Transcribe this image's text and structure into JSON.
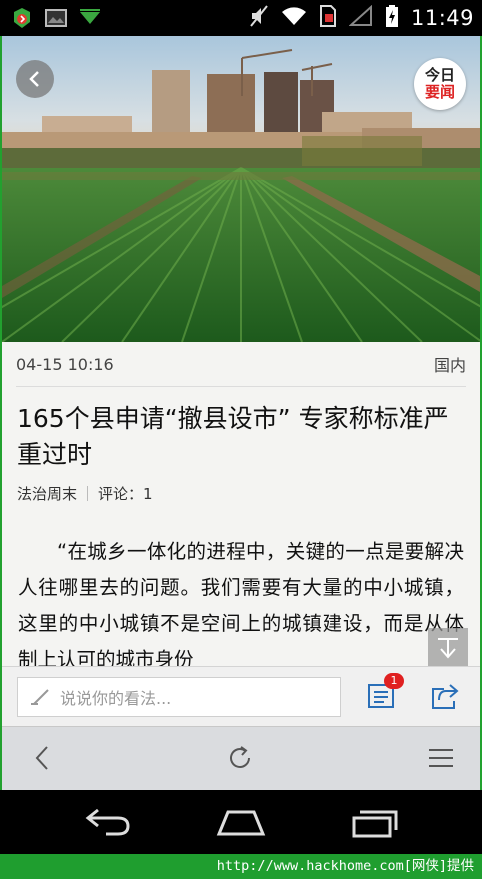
{
  "status_bar": {
    "time": "11:49",
    "icons": [
      "app-icon-green",
      "image-icon",
      "download-arrow-icon",
      "mute-icon",
      "wifi-icon",
      "no-sim-icon",
      "signal-icon",
      "battery-charging-icon"
    ]
  },
  "header": {
    "back_icon": "chevron-left-icon",
    "badge_line1": "今日",
    "badge_line2": "要闻"
  },
  "article": {
    "date": "04-15 10:16",
    "category": "国内",
    "title": "165个县申请“撤县设市” 专家称标准严重过时",
    "source": "法治周末",
    "comments_label": "评论：1",
    "body": "“在城乡一体化的进程中，关键的一点是要解决人往哪里去的问题。我们需要有大量的中小城镇，这里的中小城镇不是空间上的城镇建设，而是从体制上认可的城市身份"
  },
  "comment_bar": {
    "placeholder": "说说你的看法...",
    "comment_count": "1"
  },
  "browser_bar": {
    "icons": [
      "back-icon",
      "refresh-icon",
      "menu-icon"
    ]
  },
  "nav_bar": {
    "icons": [
      "back-arrow-icon",
      "home-icon",
      "recent-apps-icon"
    ]
  },
  "watermark": {
    "text": "http://www.hackhome.com[网侠]提供"
  },
  "colors": {
    "status_bar_bg": "#000000",
    "frame_green": "#22a12f",
    "badge_red": "#dd2222",
    "icon_blue": "#2a6fb8"
  }
}
